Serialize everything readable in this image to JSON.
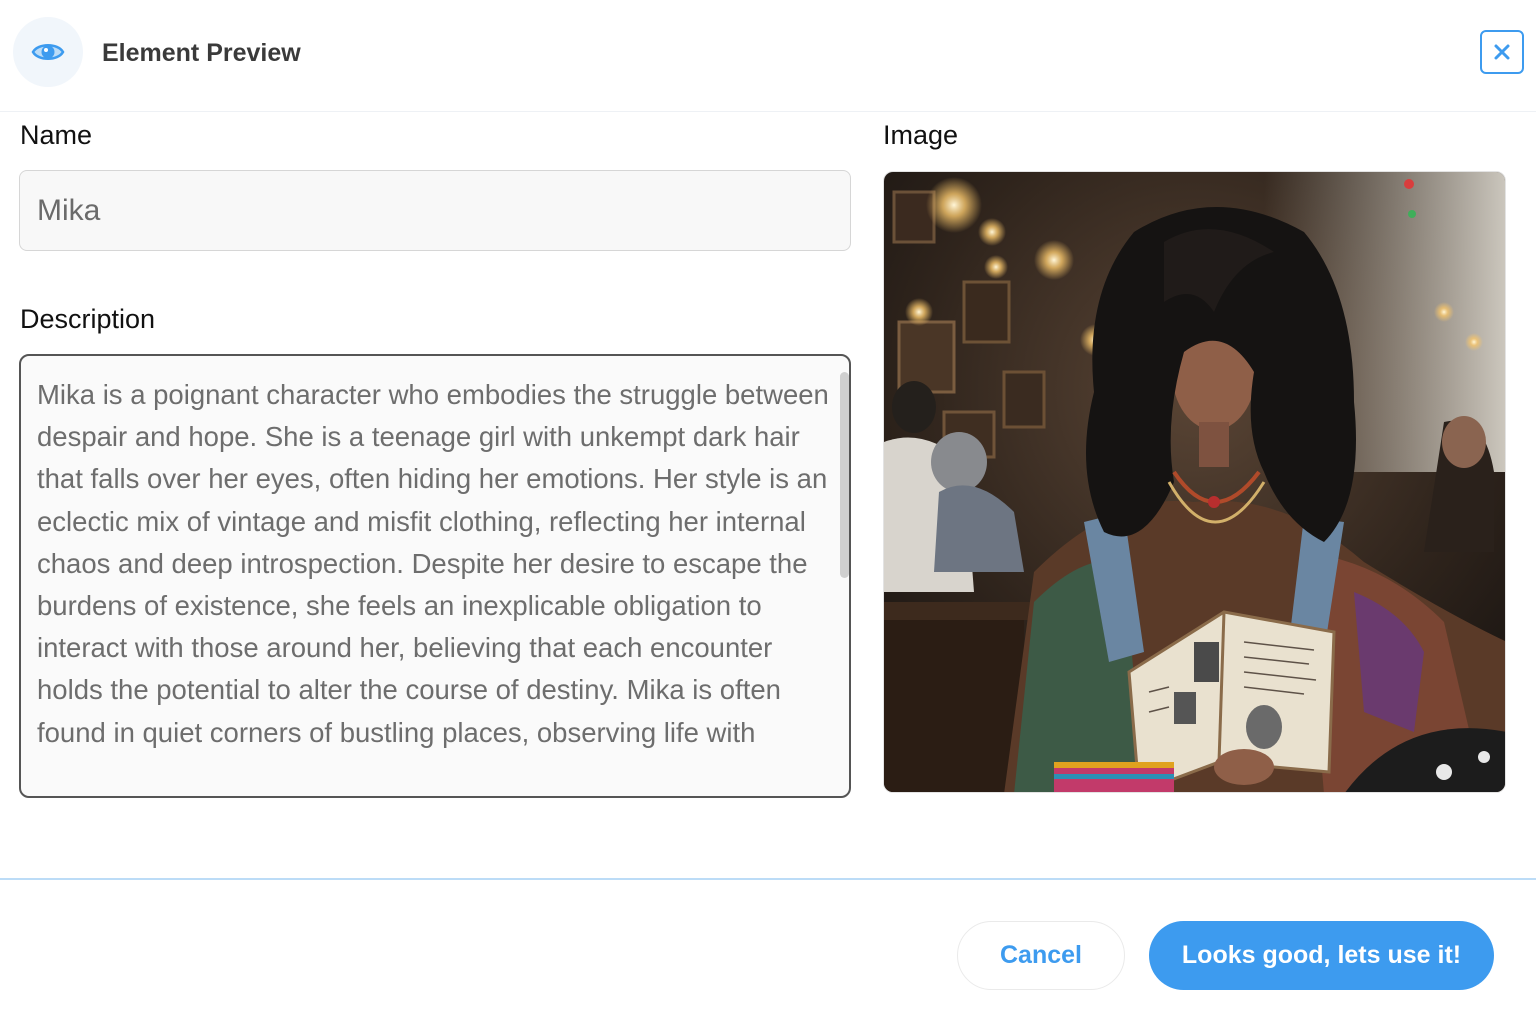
{
  "header": {
    "title": "Element Preview",
    "icon": "eye-icon",
    "close_icon": "close-icon"
  },
  "form": {
    "name_label": "Name",
    "name_value": "Mika",
    "description_label": "Description",
    "description_value": "Mika is a poignant character who embodies the struggle between despair and hope. She is a teenage girl with unkempt dark hair that falls over her eyes, often hiding her emotions. Her style is an eclectic mix of vintage and misfit clothing, reflecting her internal chaos and deep introspection. Despite her desire to escape the burdens of existence, she feels an inexplicable obligation to interact with those around her, believing that each encounter holds the potential to alter the course of destiny. Mika is often found in quiet corners of bustling places, observing life with",
    "image_label": "Image"
  },
  "footer": {
    "cancel_label": "Cancel",
    "confirm_label": "Looks good, lets use it!"
  },
  "colors": {
    "accent": "#3d9bef",
    "accent_light": "#f1f6fb"
  }
}
